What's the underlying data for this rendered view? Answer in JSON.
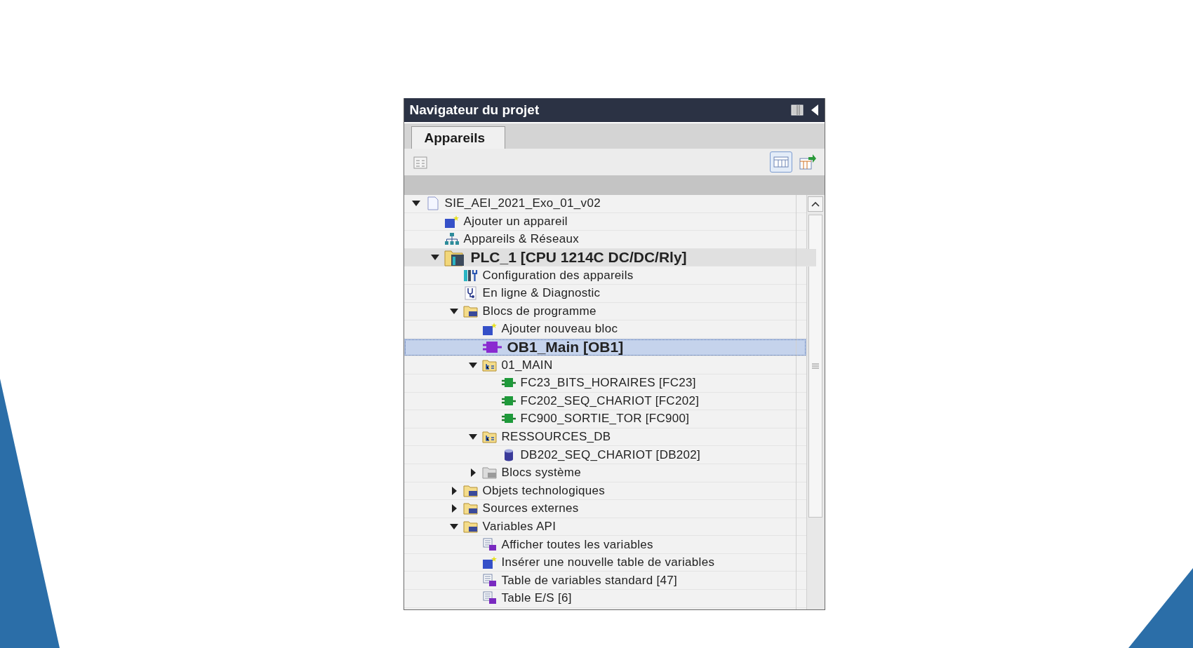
{
  "panel": {
    "title": "Navigateur du projet",
    "tabs": [
      {
        "label": "Appareils",
        "selected": true
      }
    ],
    "tree": [
      {
        "label": "SIE_AEI_2021_Exo_01_v02",
        "kind": "project",
        "expanded": true,
        "selected": false,
        "emphasized": false,
        "children": [
          {
            "label": "Ajouter un appareil",
            "kind": "add",
            "selected": false,
            "emphasized": false
          },
          {
            "label": "Appareils & Réseaux",
            "kind": "network",
            "selected": false,
            "emphasized": false
          },
          {
            "label": "PLC_1 [CPU 1214C DC/DC/Rly]",
            "kind": "plc",
            "expanded": true,
            "selected": false,
            "emphasized": true,
            "children": [
              {
                "label": "Configuration des appareils",
                "kind": "config",
                "selected": false,
                "emphasized": false
              },
              {
                "label": "En ligne & Diagnostic",
                "kind": "diagnostic",
                "selected": false,
                "emphasized": false
              },
              {
                "label": "Blocs de programme",
                "kind": "folder",
                "expanded": true,
                "selected": false,
                "emphasized": false,
                "children": [
                  {
                    "label": "Ajouter nouveau bloc",
                    "kind": "add",
                    "selected": false,
                    "emphasized": false
                  },
                  {
                    "label": "OB1_Main [OB1]",
                    "kind": "ob",
                    "selected": true,
                    "emphasized": true
                  },
                  {
                    "label": "01_MAIN",
                    "kind": "group",
                    "expanded": true,
                    "selected": false,
                    "emphasized": false,
                    "children": [
                      {
                        "label": "FC23_BITS_HORAIRES [FC23]",
                        "kind": "fc",
                        "selected": false,
                        "emphasized": false
                      },
                      {
                        "label": "FC202_SEQ_CHARIOT [FC202]",
                        "kind": "fc",
                        "selected": false,
                        "emphasized": false
                      },
                      {
                        "label": "FC900_SORTIE_TOR [FC900]",
                        "kind": "fc",
                        "selected": false,
                        "emphasized": false
                      }
                    ]
                  },
                  {
                    "label": "RESSOURCES_DB",
                    "kind": "group",
                    "expanded": true,
                    "selected": false,
                    "emphasized": false,
                    "children": [
                      {
                        "label": "DB202_SEQ_CHARIOT [DB202]",
                        "kind": "db",
                        "selected": false,
                        "emphasized": false
                      }
                    ]
                  },
                  {
                    "label": "Blocs système",
                    "kind": "folder-grey",
                    "expanded": false,
                    "selected": false,
                    "emphasized": false
                  }
                ]
              },
              {
                "label": "Objets technologiques",
                "kind": "folder",
                "expanded": false,
                "selected": false,
                "emphasized": false
              },
              {
                "label": "Sources externes",
                "kind": "folder",
                "expanded": false,
                "selected": false,
                "emphasized": false
              },
              {
                "label": "Variables API",
                "kind": "folder",
                "expanded": true,
                "selected": false,
                "emphasized": false,
                "children": [
                  {
                    "label": "Afficher toutes les variables",
                    "kind": "table",
                    "selected": false,
                    "emphasized": false
                  },
                  {
                    "label": "Insérer une nouvelle table de variables",
                    "kind": "add",
                    "selected": false,
                    "emphasized": false
                  },
                  {
                    "label": "Table de variables standard [47]",
                    "kind": "table",
                    "selected": false,
                    "emphasized": false
                  },
                  {
                    "label": "Table E/S [6]",
                    "kind": "table",
                    "selected": false,
                    "emphasized": false
                  }
                ]
              }
            ]
          }
        ]
      }
    ]
  }
}
